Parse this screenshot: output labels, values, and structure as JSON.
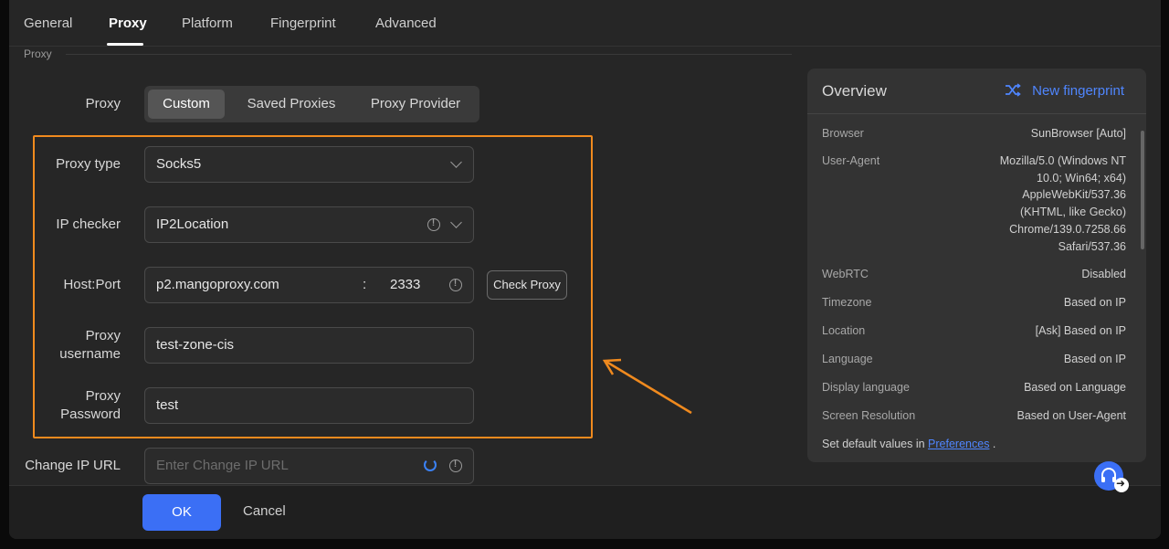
{
  "tabs": [
    "General",
    "Proxy",
    "Platform",
    "Fingerprint",
    "Advanced"
  ],
  "section": {
    "label": "Proxy"
  },
  "proxy_mode": {
    "label": "Proxy",
    "options": [
      "Custom",
      "Saved Proxies",
      "Proxy Provider"
    ],
    "selected": "Custom"
  },
  "form": {
    "proxy_type": {
      "label": "Proxy type",
      "value": "Socks5"
    },
    "ip_checker": {
      "label": "IP checker",
      "value": "IP2Location"
    },
    "host_port": {
      "label": "Host:Port",
      "host": "p2.mangoproxy.com",
      "colon": ":",
      "port": "2333",
      "check_button": "Check Proxy"
    },
    "proxy_username": {
      "label_line1": "Proxy",
      "label_line2": "username",
      "value": "test-zone-cis"
    },
    "proxy_password": {
      "label_line1": "Proxy",
      "label_line2": "Password",
      "value": "test"
    },
    "change_ip_url": {
      "label": "Change IP URL",
      "placeholder": "Enter Change IP URL"
    }
  },
  "footer": {
    "ok": "OK",
    "cancel": "Cancel"
  },
  "overview": {
    "title": "Overview",
    "new_fingerprint": "New fingerprint",
    "rows": {
      "browser": {
        "key": "Browser",
        "value": "SunBrowser [Auto]"
      },
      "user_agent": {
        "key": "User-Agent",
        "lines": [
          "Mozilla/5.0 (Windows NT",
          "10.0; Win64; x64)",
          "AppleWebKit/537.36",
          "(KHTML, like Gecko)",
          "Chrome/139.0.7258.66",
          "Safari/537.36"
        ]
      },
      "webrtc": {
        "key": "WebRTC",
        "value": "Disabled"
      },
      "timezone": {
        "key": "Timezone",
        "value": "Based on IP"
      },
      "location": {
        "key": "Location",
        "value": "[Ask] Based on IP"
      },
      "language": {
        "key": "Language",
        "value": "Based on IP"
      },
      "display_language": {
        "key": "Display language",
        "value": "Based on Language"
      },
      "screen_resolution": {
        "key": "Screen Resolution",
        "value": "Based on User-Agent"
      }
    },
    "footer_prefix": "Set default values in ",
    "footer_link": "Preferences",
    "footer_suffix": " ."
  },
  "colors": {
    "accent": "#3b6ff5",
    "highlight": "#f08a1e",
    "link": "#4f86ff"
  }
}
